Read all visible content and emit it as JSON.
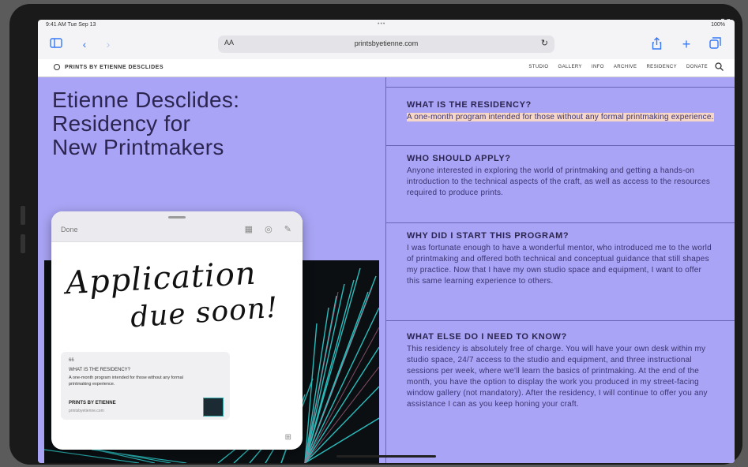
{
  "status": {
    "time": "9:41 AM  Tue Sep 13",
    "dots": "•••",
    "battery": "100%"
  },
  "browser": {
    "aa": "AA",
    "url": "printsbyetienne.com",
    "icons": {
      "sidebar": "sidebar-icon",
      "back": "chevron-left-icon",
      "forward": "chevron-right-icon",
      "reload": "reload-icon",
      "share": "share-icon",
      "new_tab": "plus-icon",
      "tabs": "tabs-icon"
    }
  },
  "site": {
    "brand": "PRINTS BY ETIENNE DESCLIDES",
    "nav": [
      "STUDIO",
      "GALLERY",
      "INFO",
      "ARCHIVE",
      "RESIDENCY",
      "DONATE"
    ]
  },
  "hero": {
    "line1": "Etienne Desclides:",
    "line2": "Residency for",
    "line3": "New Printmakers"
  },
  "faq": [
    {
      "q": "WHAT IS THE RESIDENCY?",
      "a": "A one-month program intended for those without any formal printmaking experience."
    },
    {
      "q": "WHO SHOULD APPLY?",
      "a": "Anyone interested in exploring the world of printmaking and getting a hands-on introduction to the technical aspects of the craft, as well as access to the resources required to produce prints."
    },
    {
      "q": "WHY DID I START THIS PROGRAM?",
      "a": "I was fortunate enough to have a wonderful mentor, who introduced me to the world of printmaking and offered both technical and conceptual guidance that still shapes my practice. Now that I have my own studio space and equipment, I want to offer this same learning experience to others."
    },
    {
      "q": "WHAT ELSE DO I NEED TO KNOW?",
      "a": "This residency is absolutely free of charge. You will have your own desk within my studio space, 24/7 access to the studio and equipment, and three instructional sessions per week, where we'll learn the basics of printmaking. At the end of the month, you have the option to display the work you produced in my street-facing window gallery (not mandatory). After the residency, I will continue to offer you any assistance I can as you keep honing your craft."
    }
  ],
  "quicknote": {
    "done": "Done",
    "handwriting_line1": "Application",
    "handwriting_line2": "due soon!",
    "link": {
      "marker": "66",
      "question": "WHAT IS THE RESIDENCY?",
      "desc": "A one-month program intended for those without any formal printmaking experience.",
      "brand": "PRINTS BY ETIENNE",
      "url": "printsbyetienne.com"
    }
  }
}
